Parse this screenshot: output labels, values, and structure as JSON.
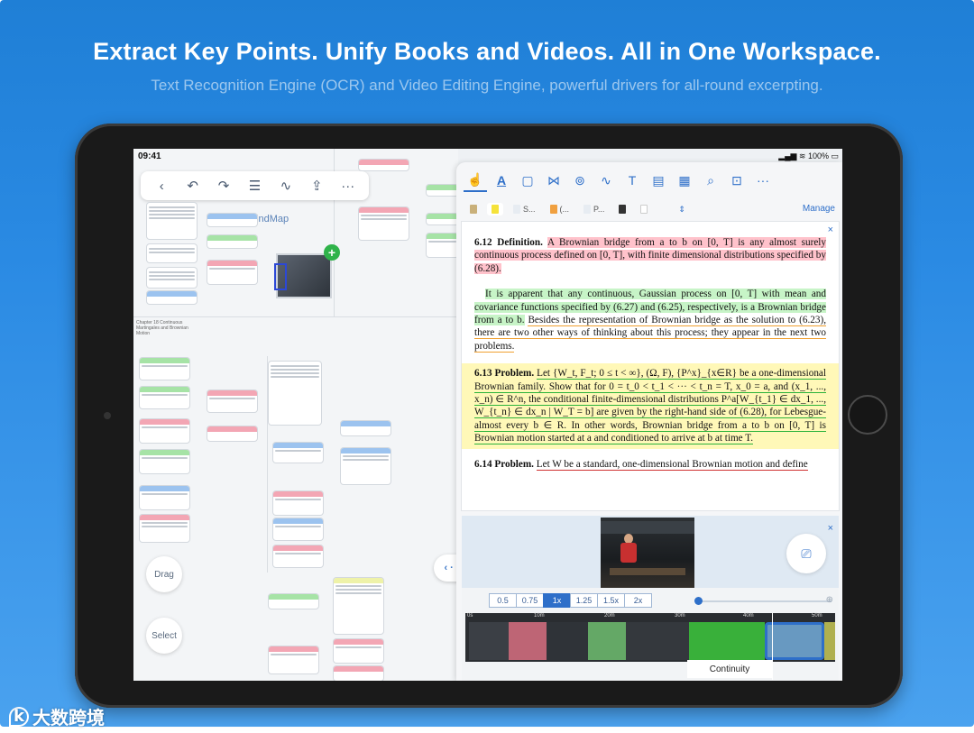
{
  "hero": {
    "headline": "Extract Key Points. Unify Books and Videos. All in One Workspace.",
    "subline": "Text Recognition Engine (OCR) and Video Editing Engine, powerful drivers for all-round excerpting."
  },
  "status_bar": {
    "time": "09:41",
    "battery": "100%"
  },
  "mindmap": {
    "title": "Main MindMap",
    "chapter": "Chapter 18 Continuous Martingales and Brownian Motion",
    "drag_label": "Drag",
    "select_label": "Select"
  },
  "doc_tabs": {
    "tab_s": "S...",
    "tab_paren": "(...",
    "tab_p": "P...",
    "manage_label": "Manage"
  },
  "document": {
    "def_612_num": "6.12",
    "def_612_title": "Definition.",
    "def_612_text": "A Brownian bridge from a to b on [0, T] is any almost surely continuous process defined on [0, T], with finite dimensional distributions specified by (6.28).",
    "para_green_a": "It is apparent that any continuous, Gaussian process on [0, T] with mean and covariance functions specified by (6.27) and (6.25), respectively, is a Brownian bridge from a to b.",
    "para_green_b": "Besides the representation of Brownian bridge as the solution to (6.23), there are two other ways of thinking about this process; they appear in the next two problems.",
    "prob_613_num": "6.13",
    "prob_613_title": "Problem.",
    "prob_613_text": "Let {W_t, F_t; 0 ≤ t < ∞}, (Ω, F), {P^x}_{x∈R} be a one-dimensional Brownian family. Show that for 0 = t_0 < t_1 < ··· < t_n = T, x_0 = a, and (x_1, ..., x_n) ∈ R^n, the conditional finite-dimensional distributions P^a[W_{t_1} ∈ dx_1, ..., W_{t_n} ∈ dx_n | W_T = b] are given by the right-hand side of (6.28), for Lebesgue-almost every b ∈ R. In other words, Brownian bridge from a to b on [0, T] is Brownian motion started at a and conditioned to arrive at b at time T.",
    "prob_614_num": "6.14",
    "prob_614_title": "Problem.",
    "prob_614_text": "Let W be a standard, one-dimensional Brownian motion and define"
  },
  "video": {
    "speeds": [
      "0.5",
      "0.75",
      "1x",
      "1.25",
      "1.5x",
      "2x"
    ],
    "active_speed": "1x",
    "ticks": [
      "0s",
      "10m",
      "20m",
      "30m",
      "40m",
      "50m"
    ],
    "continuity_label": "Continuity"
  },
  "watermark": {
    "text": "大数跨境",
    "logo": "k"
  },
  "colors": {
    "accent": "#2e6fc9",
    "highlight_red": "#ff788c",
    "highlight_green": "#82e682",
    "highlight_yellow": "#fff8b8",
    "add_badge": "#2fb34a"
  }
}
